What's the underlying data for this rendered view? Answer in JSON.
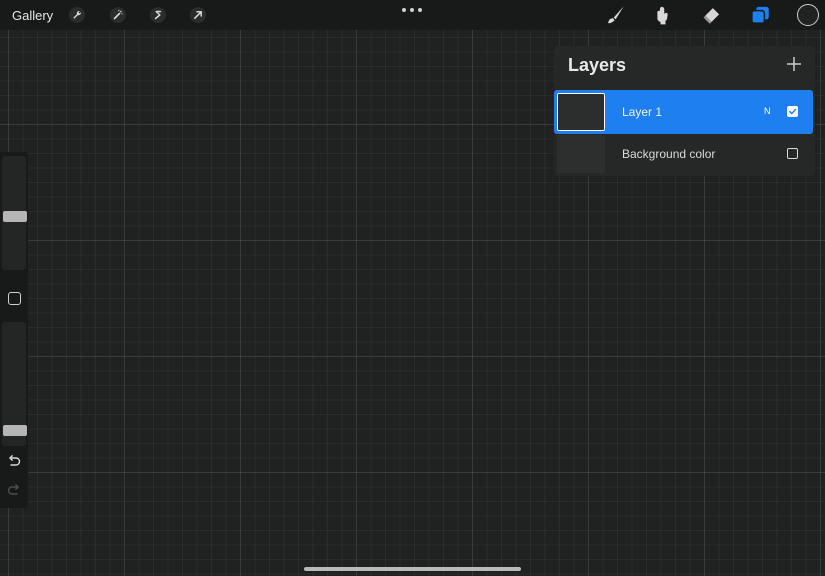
{
  "topbar": {
    "gallery_label": "Gallery",
    "left_tools": [
      "wrench-icon",
      "magic-wand-icon",
      "selection-s-icon",
      "transform-arrow-icon"
    ],
    "right_tools": [
      "brush-icon",
      "smudge-icon",
      "eraser-icon",
      "layers-icon"
    ],
    "active_tool_color": "#1e7ff0"
  },
  "layers_panel": {
    "title": "Layers",
    "add_icon": "plus-icon",
    "layers": [
      {
        "name": "Layer 1",
        "blend_mode": "N",
        "visible": true,
        "active": true
      },
      {
        "name": "Background color",
        "visible": false,
        "active": false
      }
    ]
  },
  "sidebar": {
    "brush_size": 0.47,
    "opacity": 0.09
  },
  "colors": {
    "accent": "#1e7ff0",
    "canvas": "#1f2221",
    "toolbar": "#181a19"
  }
}
